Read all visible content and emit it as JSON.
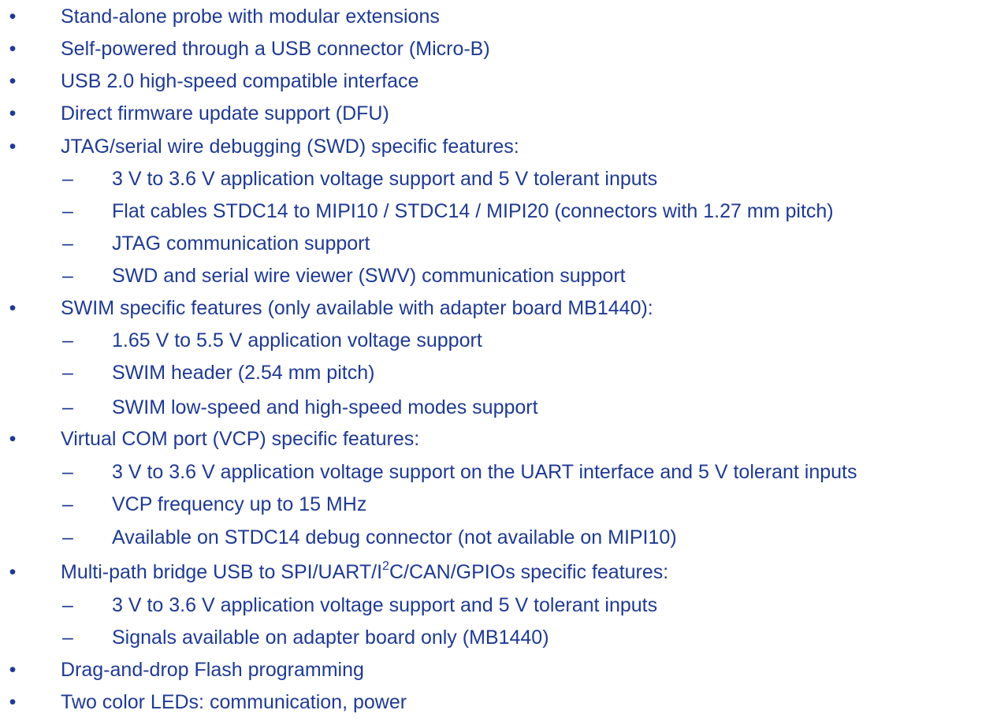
{
  "marks": {
    "bullet": "•",
    "dash": "–"
  },
  "items": [
    {
      "text": "Stand-alone probe with modular extensions"
    },
    {
      "text": "Self-powered through a USB connector (Micro-B)"
    },
    {
      "text": "USB 2.0 high-speed compatible interface"
    },
    {
      "text": "Direct firmware update support (DFU)"
    },
    {
      "text": "JTAG/serial wire debugging (SWD) specific features:",
      "sub": [
        "3 V to 3.6 V application voltage support and 5 V tolerant inputs",
        "Flat cables STDC14 to MIPI10 / STDC14 / MIPI20 (connectors with 1.27 mm pitch)",
        "JTAG communication support",
        "SWD and serial wire viewer (SWV) communication support"
      ]
    },
    {
      "text": "SWIM specific features (only available with adapter board MB1440):",
      "sub": [
        "1.65 V to 5.5 V application voltage support",
        "SWIM header (2.54 mm pitch)",
        "SWIM low-speed and high-speed modes support"
      ]
    },
    {
      "text": "Virtual COM port (VCP) specific features:",
      "sub": [
        "3 V to 3.6 V application voltage support on the UART interface and 5 V tolerant inputs",
        "VCP frequency up to 15 MHz",
        "Available on STDC14 debug connector (not available on MIPI10)"
      ]
    },
    {
      "text_before": "Multi-path bridge USB to SPI/UART/I",
      "sup": "2",
      "text_after": "C/CAN/GPIOs specific features:",
      "sub": [
        "3 V to 3.6 V application voltage support and 5 V tolerant inputs",
        "Signals available on adapter board only (MB1440)"
      ]
    },
    {
      "text": "Drag-and-drop Flash programming"
    },
    {
      "text": "Two color LEDs: communication, power"
    }
  ]
}
